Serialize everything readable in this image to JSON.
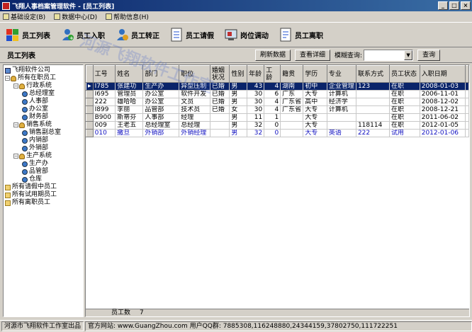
{
  "window": {
    "title": "飞翔人事档案管理软件 - [员工列表]"
  },
  "menu": [
    {
      "label": "基础设定(B)"
    },
    {
      "label": "数据中心(D)"
    },
    {
      "label": "帮助信息(H)"
    }
  ],
  "toolbar": [
    {
      "label": "员工列表",
      "icon": "employee-list-icon"
    },
    {
      "label": "员工入职",
      "icon": "employee-join-icon"
    },
    {
      "label": "员工转正",
      "icon": "employee-confirm-icon"
    },
    {
      "label": "员工请假",
      "icon": "leave-icon"
    },
    {
      "label": "岗位调动",
      "icon": "transfer-icon"
    },
    {
      "label": "员工离职",
      "icon": "resign-icon"
    }
  ],
  "subbar": {
    "title": "员工列表",
    "refresh_label": "刷新数据",
    "detail_label": "查看详细",
    "query_label": "模糊查询:",
    "query_value": "",
    "query_button": "查询"
  },
  "tree": [
    {
      "label": "飞翔软件公司",
      "depth": 0,
      "icon": "company",
      "toggle": ""
    },
    {
      "label": "所有在职员工",
      "depth": 0,
      "icon": "group",
      "toggle": "-"
    },
    {
      "label": "行政系统",
      "depth": 1,
      "icon": "group",
      "toggle": "-"
    },
    {
      "label": "总经理室",
      "depth": 2,
      "icon": "person",
      "toggle": ""
    },
    {
      "label": "人事部",
      "depth": 2,
      "icon": "person",
      "toggle": ""
    },
    {
      "label": "办公室",
      "depth": 2,
      "icon": "person",
      "toggle": ""
    },
    {
      "label": "财务部",
      "depth": 2,
      "icon": "person",
      "toggle": ""
    },
    {
      "label": "销售系统",
      "depth": 1,
      "icon": "group",
      "toggle": "-"
    },
    {
      "label": "销售副总室",
      "depth": 2,
      "icon": "person",
      "toggle": ""
    },
    {
      "label": "内销部",
      "depth": 2,
      "icon": "person",
      "toggle": ""
    },
    {
      "label": "外销部",
      "depth": 2,
      "icon": "person",
      "toggle": ""
    },
    {
      "label": "生产系统",
      "depth": 1,
      "icon": "group",
      "toggle": "-"
    },
    {
      "label": "生产办",
      "depth": 2,
      "icon": "person",
      "toggle": ""
    },
    {
      "label": "品管部",
      "depth": 2,
      "icon": "person",
      "toggle": ""
    },
    {
      "label": "仓库",
      "depth": 2,
      "icon": "person",
      "toggle": ""
    },
    {
      "label": "所有请假中员工",
      "depth": 0,
      "icon": "folder",
      "toggle": ""
    },
    {
      "label": "所有试用期员工",
      "depth": 0,
      "icon": "folder",
      "toggle": ""
    },
    {
      "label": "所有离职员工",
      "depth": 0,
      "icon": "folder",
      "toggle": ""
    }
  ],
  "table": {
    "columns": [
      "工号",
      "姓名",
      "部门",
      "职位",
      "婚姻状况",
      "性别",
      "年龄",
      "工龄",
      "籍贯",
      "学历",
      "专业",
      "联系方式",
      "员工状态",
      "入职日期"
    ],
    "rows": [
      {
        "cells": [
          "I785",
          "张建功",
          "生产办",
          "异型压制",
          "已婚",
          "男",
          "43",
          "4",
          "湖南",
          "初中",
          "企业管理",
          "123",
          "在职",
          "2008-01-03"
        ],
        "selected": true,
        "trial": false
      },
      {
        "cells": [
          "I695",
          "管理员",
          "办公室",
          "软件开发",
          "已婚",
          "男",
          "30",
          "6",
          "广东",
          "大专",
          "计算机",
          "",
          "在职",
          "2006-11-01"
        ],
        "selected": false,
        "trial": false
      },
      {
        "cells": [
          "222",
          "雄哈哈",
          "办公室",
          "文员",
          "已婚",
          "男",
          "30",
          "4",
          "广东省",
          "高中",
          "经济学",
          "",
          "在职",
          "2008-12-02"
        ],
        "selected": false,
        "trial": false
      },
      {
        "cells": [
          "I899",
          "李丽",
          "品管部",
          "技术员",
          "已婚",
          "女",
          "30",
          "4",
          "广东省",
          "大专",
          "计算机",
          "",
          "在职",
          "2008-12-21"
        ],
        "selected": false,
        "trial": false
      },
      {
        "cells": [
          "B900",
          "斯蒂芬",
          "人事部",
          "经理",
          "",
          "男",
          "11",
          "1",
          "",
          "大专",
          "",
          "",
          "在职",
          "2011-06-02"
        ],
        "selected": false,
        "trial": false
      },
      {
        "cells": [
          "009",
          "王老五",
          "总经理室",
          "总经理",
          "",
          "男",
          "32",
          "0",
          "",
          "大专",
          "",
          "118114",
          "在职",
          "2012-01-05"
        ],
        "selected": false,
        "trial": false
      },
      {
        "cells": [
          "010",
          "撒旦",
          "外销部",
          "外销经理",
          "",
          "男",
          "32",
          "0",
          "",
          "大专",
          "英语",
          "222",
          "试用",
          "2012-01-06"
        ],
        "selected": false,
        "trial": true
      }
    ],
    "footer_label": "员工数",
    "footer_count": "7"
  },
  "statusbar": {
    "company": "河源市飞翔软件工作室出品",
    "website": "官方网站: www.GuangZhou.com 用户QQ群: 7885308,116248880,24344159,37802750,111722251"
  },
  "watermark": "河源飞翔软件工作室",
  "colors": {
    "titlebar": "#0a246a",
    "selection": "#0a246a",
    "trial_text": "#1010c0"
  }
}
